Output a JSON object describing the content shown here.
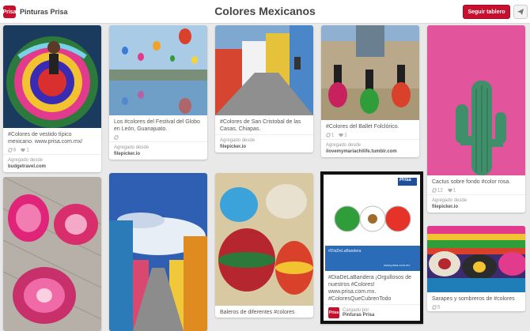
{
  "header": {
    "profile_name": "Pinturas Prisa",
    "logo_text": "Prisa",
    "board_title": "Colores Mexicanos",
    "follow_button": "Seguir tablero",
    "send_icon": "paper-plane-icon"
  },
  "pins": {
    "a1": {
      "desc": "#Colores de vestido típico mexicano. www.prisa.com.mx/",
      "repins": "6",
      "likes": "1",
      "attr_label": "Agregado desde",
      "attr_source": "budgetravel.com"
    },
    "a2": {},
    "b1": {
      "desc": "Los #colores del Festival del Globo en León, Guanajuato.",
      "repins": "",
      "likes": "",
      "attr_label": "Agregado desde",
      "attr_source": "filepicker.io"
    },
    "b2": {},
    "c1": {
      "desc": "#Colores de San Cristobal de las Casas, Chiapas.",
      "attr_label": "Agregado desde",
      "attr_source": "filepicker.io"
    },
    "c2": {
      "desc": "Baleros de diferentes #colores"
    },
    "d1": {
      "desc": "#Colores del Ballet Folclórico.",
      "repins": "1",
      "likes": "1",
      "attr_label": "Agregado desde",
      "attr_source": "ilovemymariachilife.tumblr.com"
    },
    "d2": {
      "banner_logo": "Prisa",
      "banner_caption": "#DíaDeLaBandera",
      "banner_url": "www.prisa.com.mx",
      "desc": "#DiaDeLaBandera ¡Orgullosos de nuestros #Colores! www.prisa.com.mx. #ColoresQueCubrenTodo",
      "uploaded_label": "Cargado por",
      "uploaded_by": "Pinturas Prisa",
      "avatar_text": "Prisa"
    },
    "e1": {
      "desc": "Cactus sobre fondo #color rosa.",
      "repins": "12",
      "likes": "1",
      "attr_label": "Agregado desde",
      "attr_source": "filepicker.io"
    },
    "e2": {
      "desc": "Sarapes y sombreros de #colores",
      "repins": "5"
    }
  },
  "colors": {
    "accent": "#c8102e",
    "flag_green": "#2e9d3a",
    "flag_red": "#e5332a",
    "cactus_bg": "#e2559d"
  }
}
